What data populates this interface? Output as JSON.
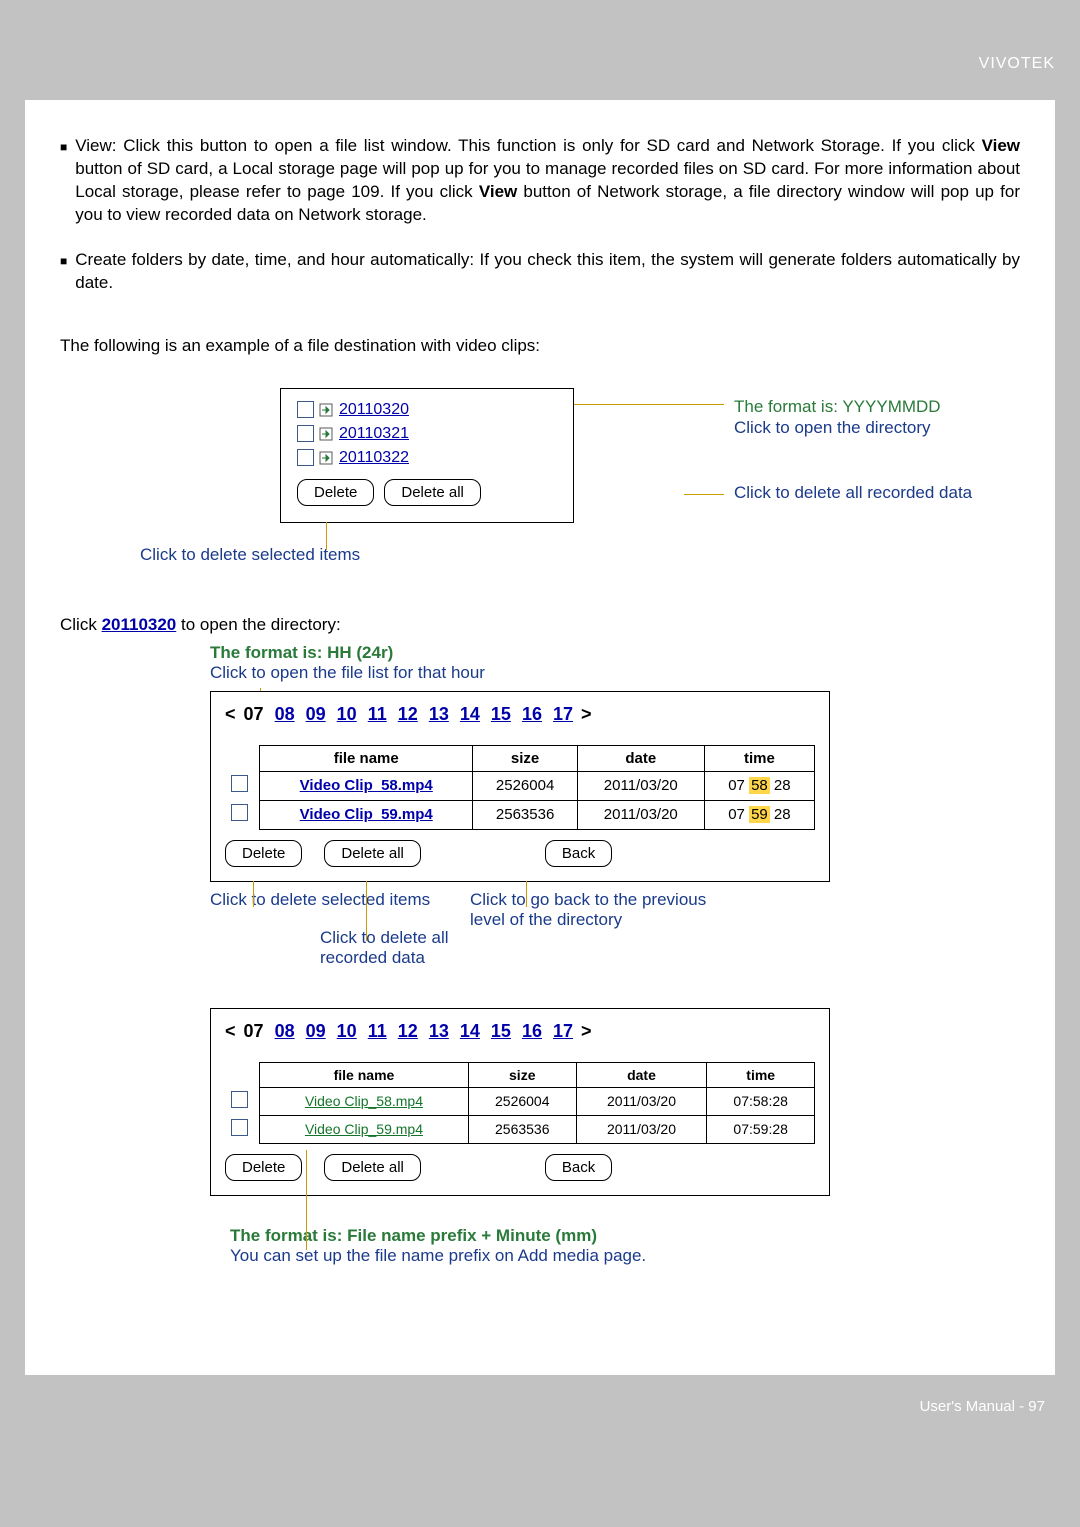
{
  "brand": "VIVOTEK",
  "bullets": {
    "view": "View: Click this button to open a file list window. This function is only for SD card and Network Storage. If you click View button of SD card, a Local storage page will pop up for you to manage recorded files on SD card. For more information about Local storage, please refer to page 109. If you click View button of Network storage, a file directory window will pop up for you to view recorded data on Network storage.",
    "create": "Create folders by date, time, and hour automatically: If you check this item, the system will generate folders automatically by date."
  },
  "example_intro": "The following is an example of a file destination with video clips:",
  "folders": {
    "items": [
      "20110320",
      "20110321",
      "20110322"
    ],
    "delete": "Delete",
    "delete_all": "Delete all",
    "format_line": "The format is: YYYYMMDD",
    "open_dir_line": "Click to open the directory",
    "delete_all_note": "Click to delete all recorded data",
    "delete_sel_note": "Click to delete selected items"
  },
  "click_folder": {
    "prefix": "Click ",
    "link": "20110320",
    "suffix": " to open the directory:"
  },
  "hh": {
    "green": "The format is: HH (24r)",
    "blue": "Click to open the file list for that hour"
  },
  "hours": {
    "current": "07",
    "links": [
      "08",
      "09",
      "10",
      "11",
      "12",
      "13",
      "14",
      "15",
      "16",
      "17"
    ]
  },
  "table": {
    "headers": {
      "name": "file name",
      "size": "size",
      "date": "date",
      "time": "time"
    },
    "rows": [
      {
        "name": "Video Clip_58.mp4",
        "size": "2526004",
        "date": "2011/03/20",
        "time_parts": [
          "07",
          "58",
          "28"
        ],
        "time": "07:58:28"
      },
      {
        "name": "Video Clip_59.mp4",
        "size": "2563536",
        "date": "2011/03/20",
        "time_parts": [
          "07",
          "59",
          "28"
        ],
        "time": "07:59:28"
      }
    ],
    "delete": "Delete",
    "delete_all": "Delete all",
    "back": "Back"
  },
  "panel1_annot": {
    "delete_sel": "Click to delete selected items",
    "delete_all": "Click to delete all recorded data",
    "back": "Click to go back to the previous level of the directory"
  },
  "prefix_note": {
    "green": "The format is: File name prefix + Minute (mm)",
    "blue": "You can set up the file name prefix on Add media page."
  },
  "footer": "User's Manual - 97"
}
